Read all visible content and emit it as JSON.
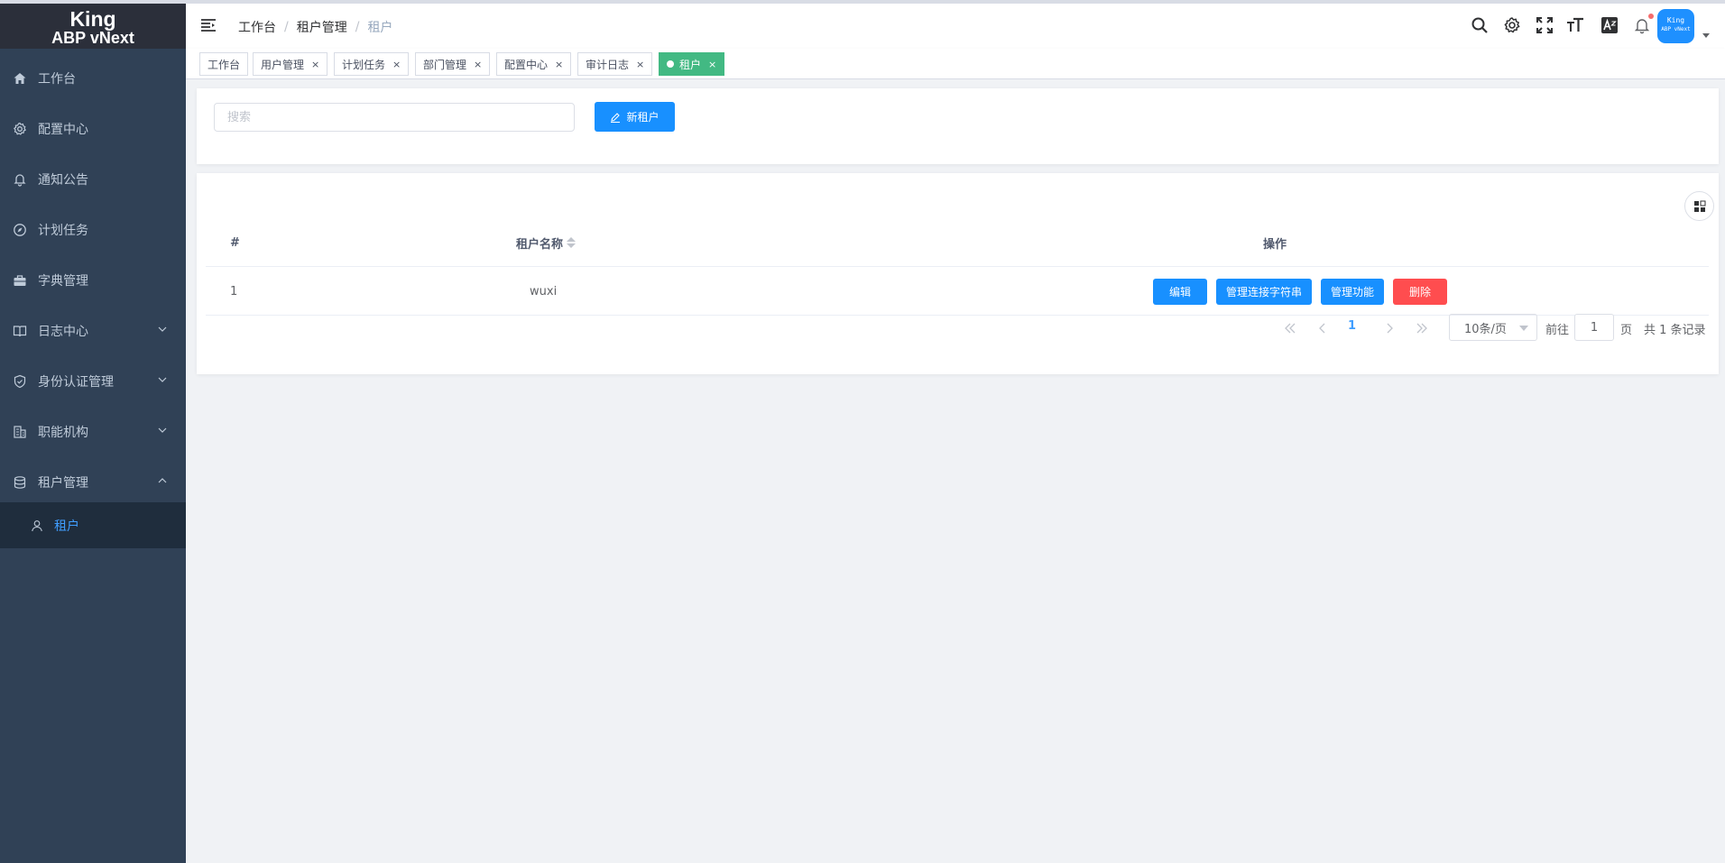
{
  "logo": {
    "line1": "King",
    "line2": "ABP vNext"
  },
  "sidebar": {
    "items": [
      {
        "label": "工作台",
        "icon": "home-icon"
      },
      {
        "label": "配置中心",
        "icon": "gear-icon"
      },
      {
        "label": "通知公告",
        "icon": "bell-icon"
      },
      {
        "label": "计划任务",
        "icon": "compass-icon"
      },
      {
        "label": "字典管理",
        "icon": "briefcase-icon"
      },
      {
        "label": "日志中心",
        "icon": "book-icon"
      },
      {
        "label": "身份认证管理",
        "icon": "shield-icon"
      },
      {
        "label": "职能机构",
        "icon": "building-icon"
      },
      {
        "label": "租户管理",
        "icon": "database-icon"
      }
    ],
    "sub_active": {
      "label": "租户",
      "icon": "user-icon"
    }
  },
  "breadcrumb": {
    "items": [
      "工作台",
      "租户管理",
      "租户"
    ]
  },
  "header": {
    "avatar_line1": "King",
    "avatar_line2": "ABP vNext"
  },
  "tags": {
    "items": [
      "工作台",
      "用户管理",
      "计划任务",
      "部门管理",
      "配置中心",
      "审计日志",
      "租户"
    ],
    "close": "×"
  },
  "search": {
    "placeholder": "搜索",
    "value": ""
  },
  "toolbar": {
    "new_label": "新租户"
  },
  "table": {
    "headers": {
      "index": "#",
      "name": "租户名称",
      "actions": "操作"
    },
    "rows": [
      {
        "index": "1",
        "name": "wuxi"
      }
    ],
    "actions": {
      "edit": "编辑",
      "conn": "管理连接字符串",
      "features": "管理功能",
      "delete": "删除"
    }
  },
  "pagination": {
    "current": "1",
    "page_size": "10条/页",
    "goto_prefix": "前往",
    "goto_value": "1",
    "goto_suffix": "页",
    "total_text": "共 1 条记录"
  },
  "colors": {
    "sidebar_bg": "#304156",
    "logo_bg": "#2b2f3a",
    "primary": "#1890ff",
    "danger": "#ff4d4f",
    "active_tag": "#42b983"
  }
}
